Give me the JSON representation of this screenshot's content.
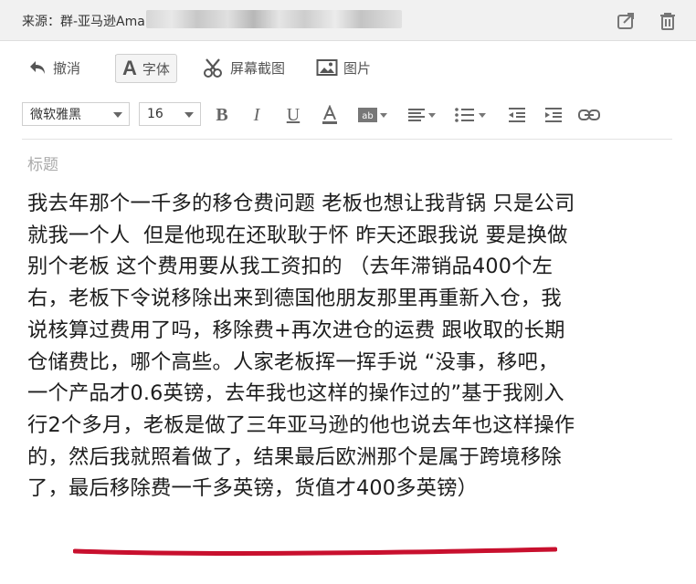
{
  "header": {
    "source_label": "来源：群-亚马逊Ama"
  },
  "toolbar": {
    "undo_label": "撤消",
    "font_label": "字体",
    "screenshot_label": "屏幕截图",
    "image_label": "图片"
  },
  "format_bar": {
    "font_family": "微软雅黑",
    "font_size": "16"
  },
  "message": {
    "subject_placeholder": "标题",
    "lines": [
      "我去年那个一千多的移仓费问题 老板也想让我背锅 只是公司",
      "就我一个人  但是他现在还耿耿于怀 昨天还跟我说 要是换做",
      "别个老板 这个费用要从我工资扣的 （去年滞销品400个左",
      "右，老板下令说移除出来到德国他朋友那里再重新入仓，我",
      "说核算过费用了吗，移除费+再次进仓的运费 跟收取的长期",
      "仓储费比，哪个高些。人家老板挥一挥手说 “没事，移吧，",
      "一个产品才0.6英镑，去年我也这样的操作过的”基于我刚入",
      "行2个多月，老板是做了三年亚马逊的他也说去年也这样操作",
      "的，然后我就照着做了，结果最后欧洲那个是属于跨境移除"
    ],
    "last_line_prefix": "了，",
    "last_line_highlight": "最后移除费一千多英镑，货值才400多英镑）"
  },
  "colors": {
    "highlight_underline": "#c8102e"
  }
}
